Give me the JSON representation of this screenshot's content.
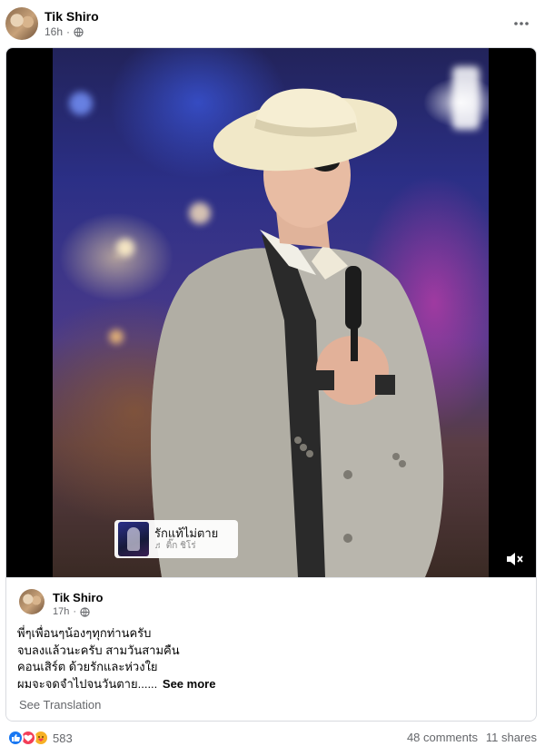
{
  "post": {
    "author": "Tik Shiro",
    "time": "16h",
    "audience_icon": "globe-icon",
    "more_icon": "more-dots-icon"
  },
  "shared_post": {
    "author": "Tik Shiro",
    "time": "17h",
    "audience_icon": "globe-icon",
    "song_sticker": {
      "title": "รักแท้ไม่ตาย",
      "artist": "♬ ติ๊ก ชิโร่"
    },
    "volume_icon": "volume-muted-icon",
    "caption_lines": [
      "พี่ๆเพื่อนๆน้องๆทุกท่านครับ",
      "จบลงแล้วนะครับ สามวันสามคืน",
      "คอนเสิร์ต ด้วยรักและห่วงใย",
      "ผมจะจดจำไปจนวันตาย......"
    ],
    "see_more": "See more",
    "see_translation": "See Translation"
  },
  "footer": {
    "reaction_icons": [
      "like-icon",
      "love-icon",
      "care-icon"
    ],
    "reaction_count": "583",
    "comments": "48 comments",
    "shares": "11 shares"
  },
  "colors": {
    "text_primary": "#050505",
    "text_secondary": "#65676b",
    "like_blue": "#1877f2",
    "love_red": "#f33e58",
    "care_yellow": "#f7b125"
  }
}
